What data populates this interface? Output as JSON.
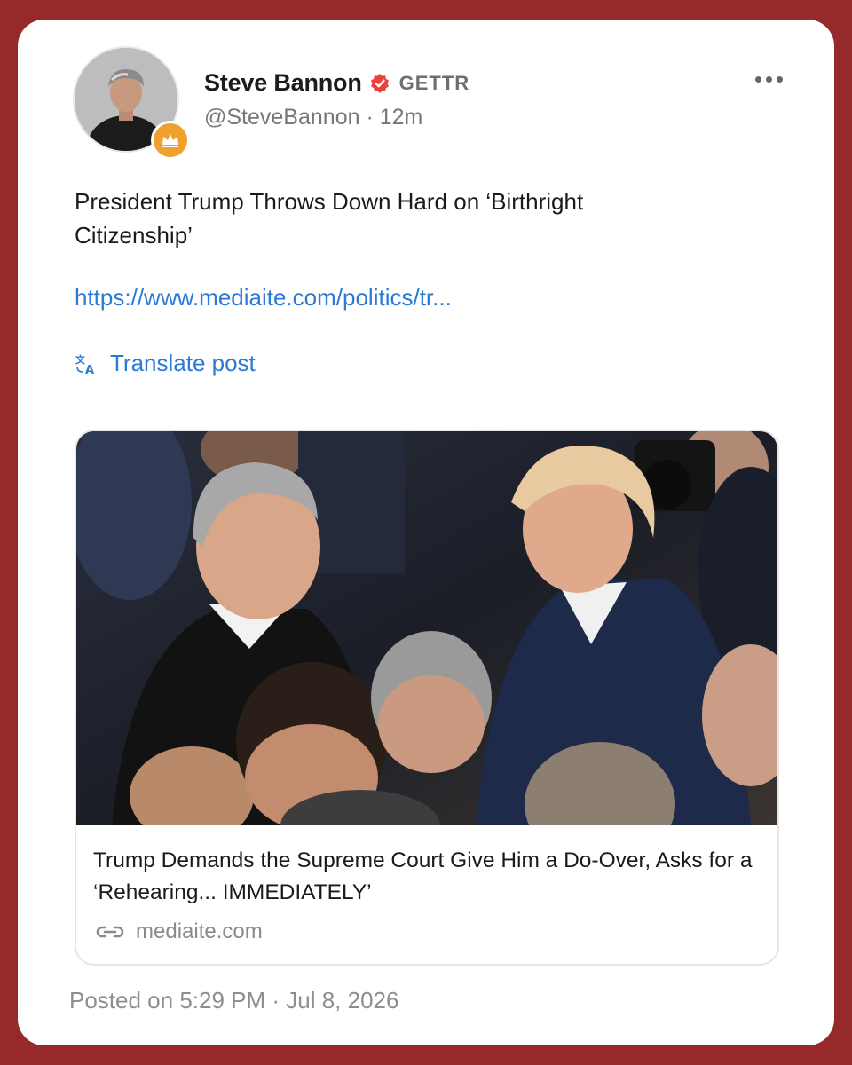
{
  "post": {
    "author": {
      "display_name": "Steve Bannon",
      "platform": "GETTR",
      "handle": "@SteveBannon",
      "time_ago": "12m",
      "separator": " · ",
      "avatar_icon": "profile-photo",
      "badge_icon": "crown-icon",
      "verified_icon": "verified-badge-icon"
    },
    "more_icon": "more-horizontal-icon",
    "text": "President Trump Throws Down Hard on ‘Birthright Citizenship’",
    "link": "https://www.mediaite.com/politics/tr...",
    "translate_label": "Translate post",
    "translate_icon": "translate-icon",
    "link_preview": {
      "title": "Trump Demands the Supreme Court Give Him a Do-Over, Asks for a ‘Rehearing... IMMEDIATELY’",
      "domain": "mediaite.com",
      "domain_icon": "link-icon"
    },
    "posted": "Posted on 5:29 PM · Jul 8, 2026"
  },
  "colors": {
    "background": "#962a2a",
    "card": "#ffffff",
    "link": "#2b7bd6",
    "verified": "#e8423a",
    "badge": "#f0a02c"
  }
}
